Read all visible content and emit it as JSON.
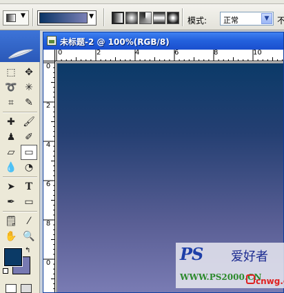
{
  "options_bar": {
    "mode_label": "模式:",
    "mode_value": "正常",
    "opacity_label_partial": "不",
    "gradient": {
      "start_color": "#0a3466",
      "end_color": "#7b80b6"
    },
    "gradient_types": [
      "linear",
      "radial",
      "angle",
      "reflected",
      "diamond"
    ]
  },
  "document": {
    "title": "未标题-2 @ 100%(RGB/8)",
    "ruler_h_labels": [
      "0",
      "2",
      "4",
      "6",
      "8",
      "10"
    ],
    "ruler_v_labels": [
      "0",
      "2",
      "4",
      "6",
      "8",
      "0"
    ],
    "canvas_gradient": {
      "top": "#0b3a68",
      "bottom": "#7a7cb4"
    }
  },
  "toolbox": {
    "foreground_color": "#0b3a66",
    "background_color": "#7779b2"
  },
  "watermark": {
    "ps_text": "PS",
    "cn_title": "爱好者",
    "url": "WWW.PS2000.CN",
    "site": "cnwg.cn"
  }
}
